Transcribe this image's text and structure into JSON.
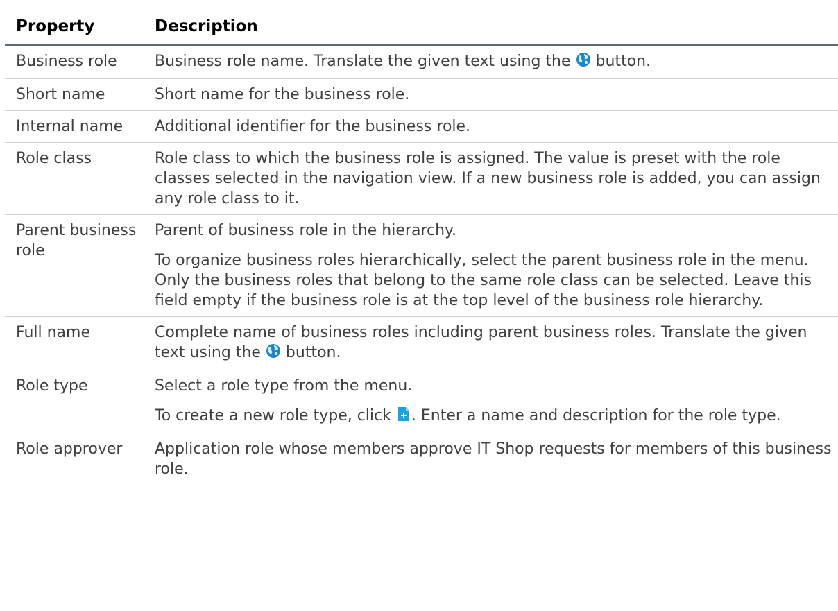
{
  "table": {
    "headers": {
      "property": "Property",
      "description": "Description"
    },
    "rows": [
      {
        "property": "Business role",
        "description": [
          {
            "before": "Business role name. Translate the given text using the",
            "icon": "globe-translate-icon",
            "after": "button."
          }
        ]
      },
      {
        "property": "Short name",
        "description": [
          {
            "text": "Short name for the business role."
          }
        ]
      },
      {
        "property": "Internal name",
        "description": [
          {
            "text": "Additional identifier for the business role."
          }
        ]
      },
      {
        "property": "Role class",
        "description": [
          {
            "text": "Role class to which the business role is assigned. The value is preset with the role classes selected in the navigation view. If a new business role is added, you can assign any role class to it."
          }
        ]
      },
      {
        "property": "Parent business role",
        "description": [
          {
            "text": "Parent of business role in the hierarchy."
          },
          {
            "text": "To organize business roles hierarchically, select the parent business role in the menu. Only the business roles that belong to the same role class can be selected. Leave this field empty if the business role is at the top level of the business role hierarchy."
          }
        ]
      },
      {
        "property": "Full name",
        "description": [
          {
            "before": "Complete name of business roles including parent business roles. Translate the given text using the",
            "icon": "globe-translate-icon",
            "after": "button."
          }
        ]
      },
      {
        "property": "Role type",
        "description": [
          {
            "text": "Select a role type from the menu."
          },
          {
            "before": "To create a new role type, click",
            "icon": "add-document-icon",
            "after": ". Enter a name and description for the role type."
          }
        ]
      },
      {
        "property": "Role approver",
        "description": [
          {
            "text": "Application role whose members approve IT Shop requests for members of this business role."
          }
        ]
      }
    ]
  },
  "icons": {
    "globe-translate-icon": {
      "color": "#1a86d0"
    },
    "add-document-icon": {
      "color": "#1aa3e0"
    }
  }
}
